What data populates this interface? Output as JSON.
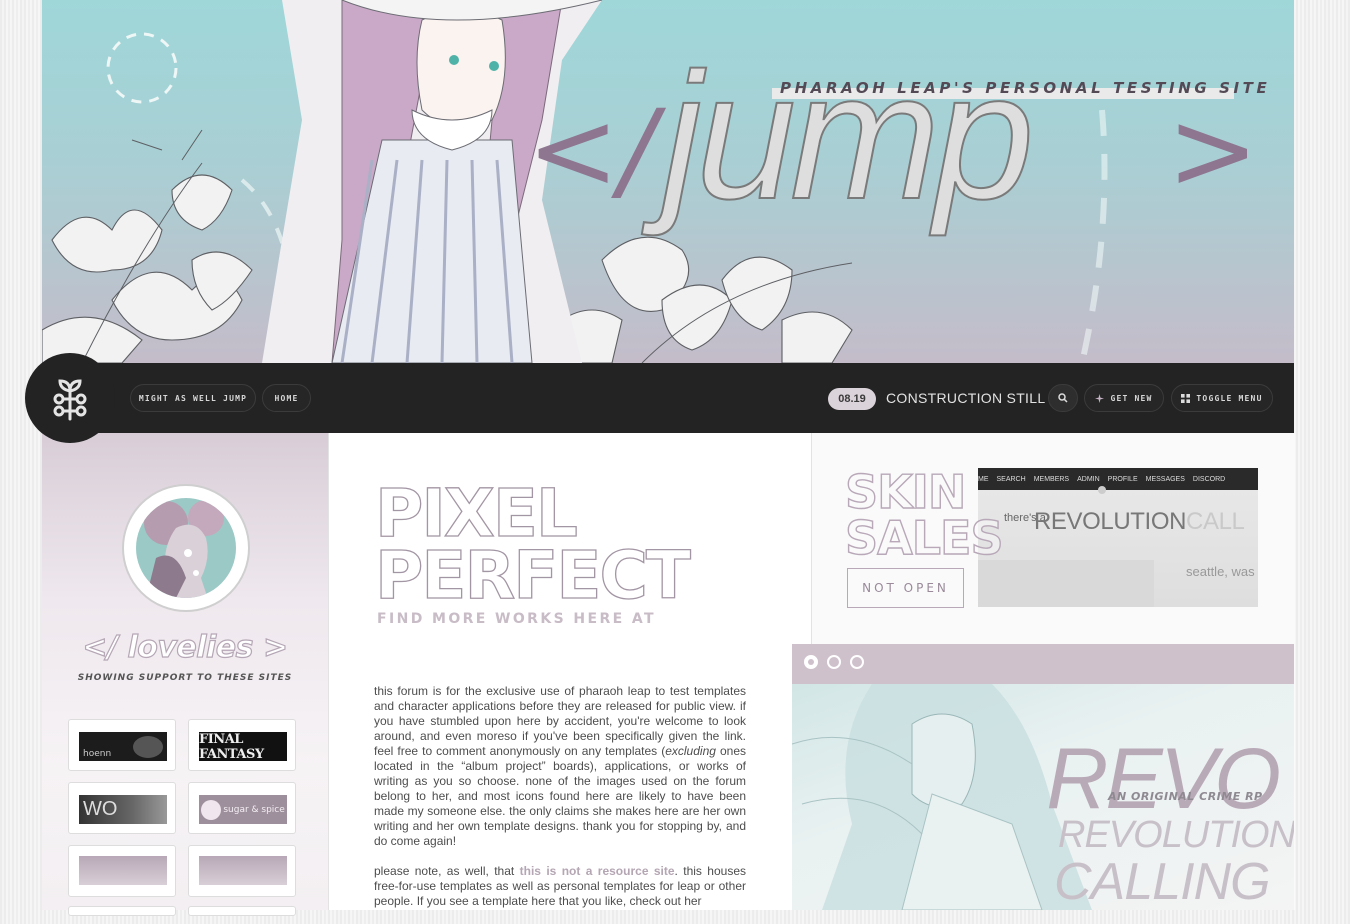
{
  "banner": {
    "tagline": "PHARAOH LEAP'S PERSONAL TESTING SITE",
    "logo_text": "</jump>"
  },
  "nav": {
    "brand_icon": "plant-sprout-icon",
    "links": [
      "MIGHT AS WELL JUMP",
      "HOME"
    ],
    "date": "08.19",
    "ticker": "CONSTRUCTION STILL UNDERWAY",
    "search_icon": "search-icon",
    "get_new": "GET NEW",
    "toggle_menu": "TOGGLE MENU"
  },
  "sidebar": {
    "title": "</ lovelies >",
    "subtitle": "SHOWING SUPPORT TO THESE SITES",
    "affiliates": [
      {
        "label": "hoenn"
      },
      {
        "label": "FINAL FANTASY"
      },
      {
        "label": "WO"
      },
      {
        "label": "sugar & spice"
      },
      {
        "label": ""
      },
      {
        "label": ""
      }
    ]
  },
  "main": {
    "heading_line1": "PIXEL",
    "heading_line2": "PERFECT",
    "find_more": "FIND MORE WORKS HERE AT",
    "para1_a": "this forum is for the exclusive use of pharaoh leap to test templates and character applications before they are released for public view. if you have stumbled upon here by accident, you're welcome to look around, and even moreso if you've been specifically given the link. feel free to comment anonymously on any templates (",
    "para1_em": "excluding",
    "para1_b": " ones located in the “album project” boards), applications, or works of writing as you so choose. none of the images used on the forum belong to her, and most icons found here are likely to have been made my someone else. the only claims she makes here are her own writing and her own template designs. thank you for stopping by, and do come again!",
    "para2_a": "please note, as well, that ",
    "para2_hl": "this is not a resource site",
    "para2_b": ". this houses free-for-use templates as well as personal templates for leap or other people. If you see a template here that you like, check out her"
  },
  "skin_sales": {
    "title_line1": "SKIN",
    "title_line2": "SALES",
    "status_button": "NOT OPEN",
    "preview": {
      "nav_items": [
        "ME",
        "SEARCH",
        "MEMBERS",
        "ADMIN",
        "PROFILE",
        "MESSAGES",
        "DISCORD"
      ],
      "hero_a": "REVOLUTION",
      "hero_b": "CALL",
      "side_text": "there's a",
      "city": "seattle, was"
    }
  },
  "revo": {
    "big": "REVO",
    "tagline": "AN ORIGINAL CRIME RP",
    "line1": "REVOLUTION",
    "line2": "CALLING",
    "slider_dots": 3,
    "active_dot": 0
  },
  "colors": {
    "nav_bg": "#232323",
    "accent_mauve": "#b4a6b3",
    "banner_teal": "#9fd7d9"
  }
}
